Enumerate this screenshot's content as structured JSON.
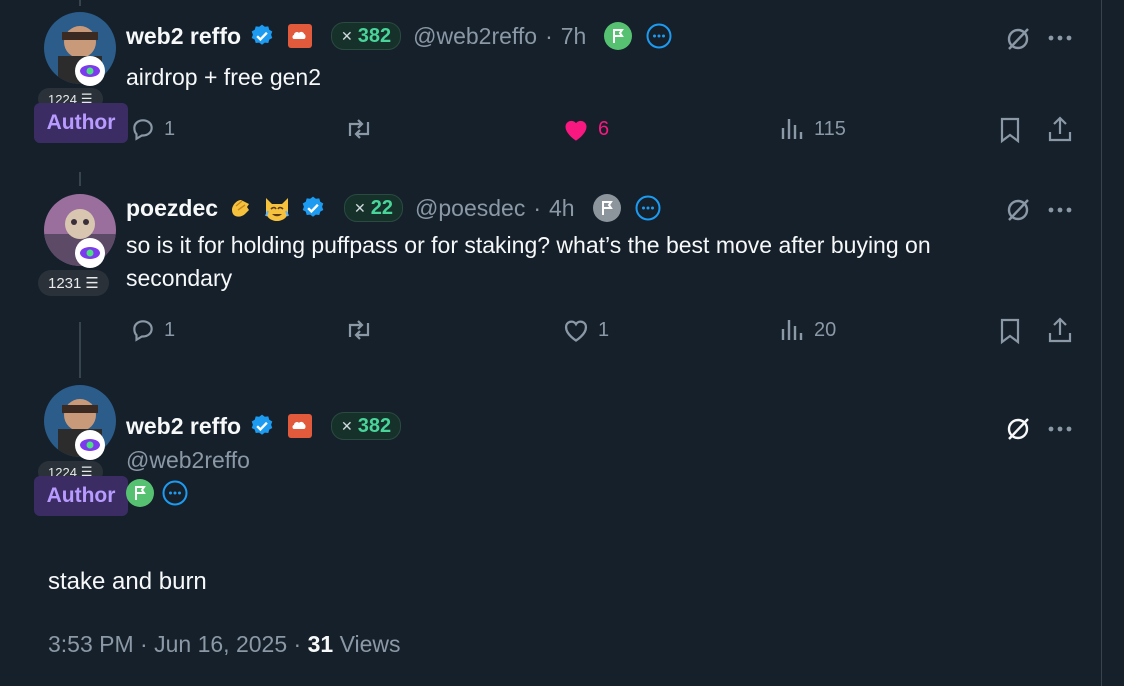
{
  "tweets": [
    {
      "name": "web2 reffo",
      "score": "382",
      "handle": "@web2reffo",
      "dot": "·",
      "time": "7h",
      "rank": "1224",
      "author_label": "Author",
      "text": "airdrop + free gen2",
      "replies": "1",
      "likes": "6",
      "views": "115",
      "liked": true
    },
    {
      "name": "poezdec",
      "score": "22",
      "handle": "@poesdec",
      "dot": "·",
      "time": "4h",
      "rank": "1231",
      "text_line1": "so is it for holding puffpass or for staking? what’s the best move after buying on",
      "text_line2": "secondary",
      "replies": "1",
      "likes": "1",
      "views": "20",
      "liked": false
    }
  ],
  "main": {
    "name": "web2 reffo",
    "score": "382",
    "handle": "@web2reffo",
    "rank": "1224",
    "author_label": "Author",
    "text": "stake and burn",
    "time": "3:53 PM",
    "date": "Jun 16, 2025",
    "views_count": "31",
    "views_label": "Views",
    "dot": "·"
  },
  "colors": {
    "background": "#15202b",
    "like_active": "#f91880",
    "verified": "#1d9bf0",
    "score_green": "#49d49a",
    "author_purple": "#b89bff"
  },
  "icons": [
    "verified-icon",
    "cloud-badge-icon",
    "x-score-icon",
    "flag-icon",
    "more-circle-icon",
    "grok-icon",
    "more-icon",
    "reply-icon",
    "retweet-icon",
    "like-icon",
    "views-icon",
    "bookmark-icon",
    "share-icon",
    "eye-icon",
    "rank-list-icon"
  ]
}
